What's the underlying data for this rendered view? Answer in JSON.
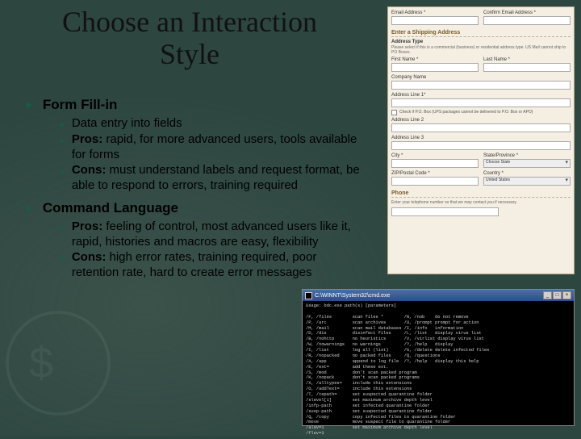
{
  "title": "Choose an Interaction Style",
  "sections": [
    {
      "heading": "Form Fill-in",
      "bullets": [
        {
          "label": "",
          "text": "Data entry into fields"
        },
        {
          "label": "Pros:",
          "text": " rapid, for more advanced users, tools available for forms"
        },
        {
          "label": "Cons:",
          "text": " must understand labels and request format, be able to respond to errors, training required"
        }
      ]
    },
    {
      "heading": "Command Language",
      "bullets": [
        {
          "label": "Pros:",
          "text": " feeling of control, most advanced users like it, rapid, histories and macros are easy, flexibility"
        },
        {
          "label": "Cons:",
          "text": " high error rates, training required, poor retention rate, hard to create error messages"
        }
      ]
    }
  ],
  "form": {
    "emailLabel": "Email Address *",
    "confirmEmailLabel": "Confirm Email Address *",
    "shippingHeader": "Enter a Shipping Address",
    "addrTypeHeader": "Address Type",
    "addrHint": "Please select if this is a commercial (business) or residential address type. US Mail cannot ship to PO Boxes.",
    "firstNameLabel": "First Name *",
    "lastNameLabel": "Last Name *",
    "companyLabel": "Company Name",
    "addr1Label": "Address Line 1*",
    "aptCheck": "Check if P.O. Box (UPS packages cannot be delivered to P.O. Box or APO)",
    "addr2Label": "Address Line 2",
    "addr3Label": "Address Line 3",
    "cityLabel": "City *",
    "stateLabel": "State/Province *",
    "stateValue": "Choose State",
    "zipLabel": "ZIP/Postal Code *",
    "countryLabel": "Country *",
    "countryValue": "United States",
    "phoneHeader": "Phone",
    "phoneHint": "Enter your telephone number so that we may contact you if necessary."
  },
  "cmd": {
    "windowTitle": "C:\\WINNT\\System32\\cmd.exe",
    "usageLine": "Usage: bdc.exe path(s) [parameters]",
    "lines": [
      "/F, /files        scan files *        /N, /nob    do not remove",
      "/P, /arc          scan archives       /U, /prompt prompt for action",
      "/M, /mail         scan mail databases /I, /info   information",
      "/D, /dis          disinfect files     /L, /list   display virus list",
      "/B, /nohttp       no heuristics       /V, /virlist display virus list",
      "/W, /nowarnings   no warnings         /?, /help   display",
      "/I, /list         log all (list)      /G, /delete delete infected files",
      "/R, /nopacked     no packed files     /Q, /questions",
      "/A, /app          append to log file  /?, /help   display this help",
      "/E, /ext=         add these ext.",
      "/S, /mod          don't scan packed program",
      "/K, /nopack       don't scan packed programs",
      "/X, /alltypes=    include this extensions",
      "/O, /addText=     include this extensions",
      "/T, /tepath=      set suspected quarantine folder",
      "/slevel[1]        set maximum archive depth level",
      "/infp-path        set infected quarantine folder",
      "/susp-path        set suspected quarantine folder",
      "/Q, /copy         copy infected files to quarantine folder",
      "/move             move suspect file to quarantine folder",
      "/alev=1           set maximum archive depth level",
      "/flev=3"
    ]
  }
}
